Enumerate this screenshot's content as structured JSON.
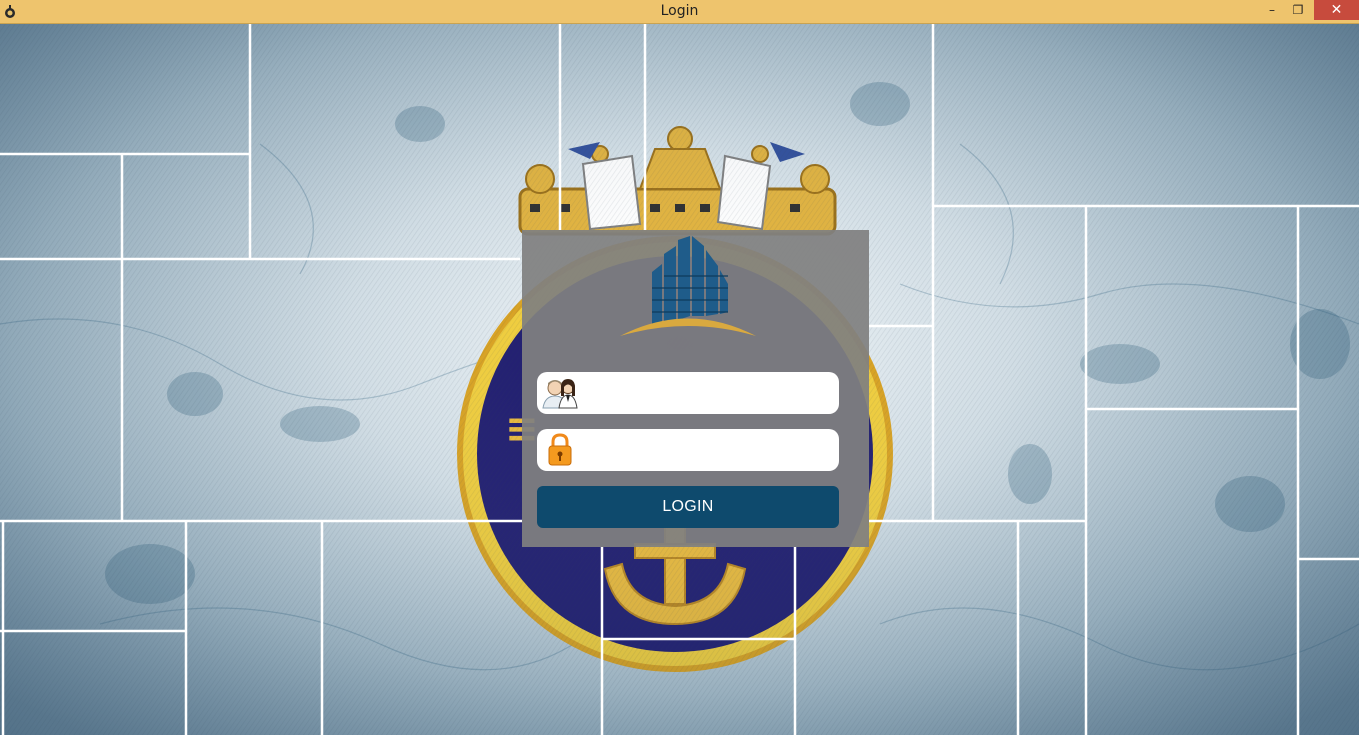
{
  "window": {
    "title": "Login",
    "controls": {
      "minimize": "–",
      "maximize": "❐",
      "close": "✕"
    }
  },
  "login": {
    "username": {
      "icon": "users-icon",
      "value": "",
      "placeholder": ""
    },
    "password": {
      "icon": "lock-icon",
      "value": "",
      "placeholder": ""
    },
    "button_label": "LOGIN"
  },
  "colors": {
    "titlebar": "#eec46d",
    "close_button": "#c74b3d",
    "panel": "#808080",
    "login_button": "#0e4a6d",
    "logo_blue": "#1f5c8a",
    "logo_gold": "#d9a93f"
  },
  "background": {
    "image": "naval-crest-over-map"
  }
}
